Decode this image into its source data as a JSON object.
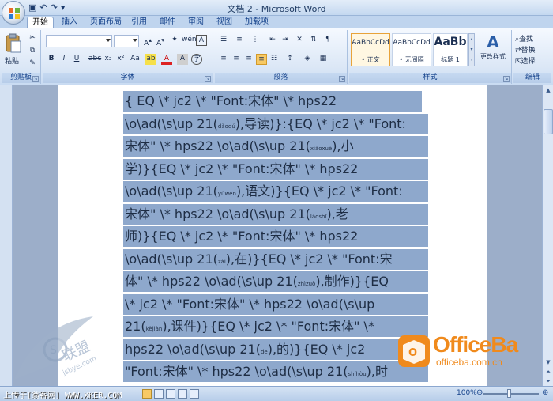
{
  "window": {
    "title": "文档 2 - Microsoft Word"
  },
  "tabs": [
    "开始",
    "插入",
    "页面布局",
    "引用",
    "邮件",
    "审阅",
    "视图",
    "加载项"
  ],
  "ribbon": {
    "clipboard": {
      "paste_label": "粘贴",
      "group_label": "剪贴板"
    },
    "font": {
      "group_label": "字体",
      "font_name": "",
      "font_size": ""
    },
    "paragraph": {
      "group_label": "段落"
    },
    "styles": {
      "group_label": "样式",
      "items": [
        {
          "sample": "AaBbCcDd",
          "name": "• 正文"
        },
        {
          "sample": "AaBbCcDd",
          "name": "• 无间隔"
        },
        {
          "sample": "AaBb",
          "name": "标题 1"
        }
      ],
      "change_styles_label": "更改样式"
    },
    "editing": {
      "group_label": "编辑",
      "find": "查找",
      "replace": "替换",
      "select": "选择"
    }
  },
  "document": {
    "lines": [
      [
        {
          "t": "{ EQ  \\*  jc2  \\*  \"Font:宋体\"  \\*  hps22"
        }
      ],
      [
        {
          "t": "\\o\\ad(\\s\\up 21("
        },
        {
          "r": "dǎodú"
        },
        {
          "t": "),导读)}:{EQ \\* jc2 \\* \"Font:"
        }
      ],
      [
        {
          "t": "宋体\"  \\*  hps22  \\o\\ad(\\s\\up  21("
        },
        {
          "r": "xiǎoxué"
        },
        {
          "t": "),小"
        }
      ],
      [
        {
          "t": "学)}{EQ  \\*  jc2  \\*  \"Font:宋体\"  \\*  hps22"
        }
      ],
      [
        {
          "t": "\\o\\ad(\\s\\up 21("
        },
        {
          "r": "yǔwén"
        },
        {
          "t": "),语文)}{EQ \\* jc2 \\* \"Font:"
        }
      ],
      [
        {
          "t": "宋体\"  \\*  hps22  \\o\\ad(\\s\\up  21("
        },
        {
          "r": "lǎoshī"
        },
        {
          "t": "),老"
        }
      ],
      [
        {
          "t": "师)}{EQ  \\*  jc2  \\*  \"Font:宋体\"  \\*  hps22"
        }
      ],
      [
        {
          "t": "\\o\\ad(\\s\\up 21("
        },
        {
          "r": "zài"
        },
        {
          "t": "),在)}{EQ \\* jc2 \\* \"Font:宋"
        }
      ],
      [
        {
          "t": "体\" \\* hps22 \\o\\ad(\\s\\up 21("
        },
        {
          "r": "zhìzuò"
        },
        {
          "t": "),制作)}{EQ"
        }
      ],
      [
        {
          "t": "\\* jc2 \\* \"Font:宋体\" \\* hps22 \\o\\ad(\\s\\up"
        }
      ],
      [
        {
          "t": "21("
        },
        {
          "r": "kèjiàn"
        },
        {
          "t": "),课件)}{EQ  \\*  jc2  \\*  \"Font:宋体\"  \\*"
        }
      ],
      [
        {
          "t": "hps22  \\o\\ad(\\s\\up  21("
        },
        {
          "r": "de"
        },
        {
          "t": "),的)}{EQ  \\*  jc2"
        }
      ],
      [
        {
          "t": "\"Font:宋体\" \\* hps22 \\o\\ad(\\s\\up 21("
        },
        {
          "r": "shíhòu"
        },
        {
          "t": "),时"
        }
      ]
    ]
  },
  "statusbar": {
    "text": "上传于[翁客网] WWW.XKER.COM",
    "zoom": "100%"
  },
  "watermark": {
    "brand": "OfficeBa",
    "url": "officeba.com.cn",
    "left_brand": "联盟",
    "left_url": "jsbye.com"
  }
}
